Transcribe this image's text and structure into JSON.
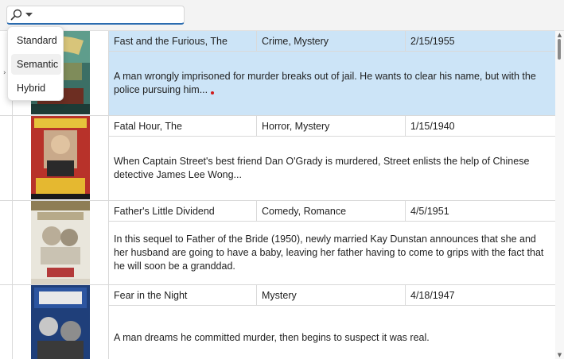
{
  "search": {
    "mode_icon": "search-icon",
    "dropdown_icon": "chevron-down-icon",
    "placeholder": "",
    "value": "",
    "modes": [
      "Standard",
      "Semantic",
      "Hybrid"
    ],
    "active_mode": "Semantic"
  },
  "movies": [
    {
      "title": "Fast and the Furious, The",
      "genre": "Crime, Mystery",
      "date": "2/15/1955",
      "description": "A man wrongly imprisoned for murder breaks out of jail. He wants to clear his name, but with the police pursuing him...",
      "poster_colors": [
        "#4a8a7c",
        "#c9b36a",
        "#7a3a2a"
      ],
      "selected": true
    },
    {
      "title": "Fatal Hour, The",
      "genre": "Horror, Mystery",
      "date": "1/15/1940",
      "description": "When Captain Street's best friend Dan O'Grady is murdered, Street enlists the help of Chinese detective James Lee Wong...",
      "poster_colors": [
        "#c0392b",
        "#e8c23a",
        "#2c2c2c"
      ],
      "selected": false
    },
    {
      "title": "Father's Little Dividend",
      "genre": "Comedy, Romance",
      "date": "4/5/1951",
      "description": "In this sequel to Father of the Bride (1950), newly married Kay Dunstan announces that she and her husband are going to have a baby, leaving her father having to come to grips with the fact that he will soon be a granddad.",
      "poster_colors": [
        "#d8d4c8",
        "#8a7f6a",
        "#b23a3a"
      ],
      "selected": false
    },
    {
      "title": "Fear in the Night",
      "genre": "Mystery",
      "date": "4/18/1947",
      "description": "A man dreams he committed murder, then begins to suspect it was real.",
      "poster_colors": [
        "#1f3f7a",
        "#d9d9d9",
        "#3a3a3a"
      ],
      "selected": false
    }
  ]
}
